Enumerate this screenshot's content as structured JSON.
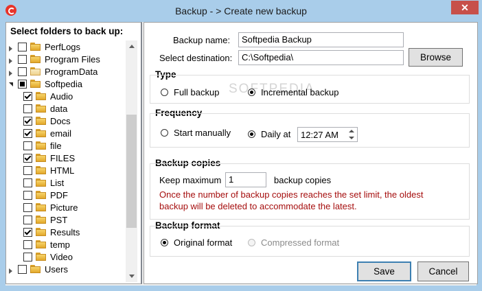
{
  "window": {
    "title": "Backup - > Create new backup",
    "close_label": "✕"
  },
  "folder_panel": {
    "header": "Select folders to back up:",
    "items": [
      {
        "label": "PerfLogs",
        "level": 0,
        "expander": "plus",
        "check": "unchecked",
        "faded": false
      },
      {
        "label": "Program Files",
        "level": 0,
        "expander": "plus",
        "check": "unchecked",
        "faded": false
      },
      {
        "label": "ProgramData",
        "level": 0,
        "expander": "plus",
        "check": "unchecked",
        "faded": true
      },
      {
        "label": "Softpedia",
        "level": 0,
        "expander": "minus",
        "check": "partial",
        "faded": false
      },
      {
        "label": "Audio",
        "level": 1,
        "expander": "none",
        "check": "checked",
        "faded": false
      },
      {
        "label": "data",
        "level": 1,
        "expander": "none",
        "check": "unchecked",
        "faded": false
      },
      {
        "label": "Docs",
        "level": 1,
        "expander": "none",
        "check": "checked",
        "faded": false
      },
      {
        "label": "email",
        "level": 1,
        "expander": "none",
        "check": "checked",
        "faded": false
      },
      {
        "label": "file",
        "level": 1,
        "expander": "none",
        "check": "unchecked",
        "faded": false
      },
      {
        "label": "FILES",
        "level": 1,
        "expander": "none",
        "check": "checked",
        "faded": false
      },
      {
        "label": "HTML",
        "level": 1,
        "expander": "none",
        "check": "unchecked",
        "faded": false
      },
      {
        "label": "List",
        "level": 1,
        "expander": "none",
        "check": "unchecked",
        "faded": false
      },
      {
        "label": "PDF",
        "level": 1,
        "expander": "none",
        "check": "unchecked",
        "faded": false
      },
      {
        "label": "Picture",
        "level": 1,
        "expander": "none",
        "check": "unchecked",
        "faded": false
      },
      {
        "label": "PST",
        "level": 1,
        "expander": "none",
        "check": "unchecked",
        "faded": false
      },
      {
        "label": "Results",
        "level": 1,
        "expander": "none",
        "check": "checked",
        "faded": false
      },
      {
        "label": "temp",
        "level": 1,
        "expander": "none",
        "check": "unchecked",
        "faded": false
      },
      {
        "label": "Video",
        "level": 1,
        "expander": "none",
        "check": "unchecked",
        "faded": false
      },
      {
        "label": "Users",
        "level": 0,
        "expander": "plus",
        "check": "unchecked",
        "faded": false
      }
    ]
  },
  "backup_name": {
    "label": "Backup name:",
    "value": "Softpedia Backup"
  },
  "destination": {
    "label": "Select destination:",
    "value": "C:\\Softpedia\\",
    "browse_label": "Browse"
  },
  "watermark": "SOFTPEDIA",
  "type_group": {
    "title": "Type",
    "options": [
      {
        "label": "Full backup",
        "selected": false
      },
      {
        "label": "Incremental backup",
        "selected": true
      }
    ]
  },
  "frequency_group": {
    "title": "Frequency",
    "options": [
      {
        "label": "Start manually",
        "selected": false
      },
      {
        "label": "Daily at",
        "selected": true
      }
    ],
    "time_value": "12:27 AM"
  },
  "copies_group": {
    "title": "Backup copies",
    "prefix": "Keep maximum",
    "value": "1",
    "suffix": "backup copies",
    "warning_line1": "Once the number of backup copies reaches the set limit, the oldest",
    "warning_line2": "backup will be deleted to accommodate the latest."
  },
  "format_group": {
    "title": "Backup format",
    "options": [
      {
        "label": "Original format",
        "selected": true,
        "disabled": false
      },
      {
        "label": "Compressed format",
        "selected": false,
        "disabled": true
      }
    ]
  },
  "actions": {
    "save_label": "Save",
    "cancel_label": "Cancel"
  }
}
